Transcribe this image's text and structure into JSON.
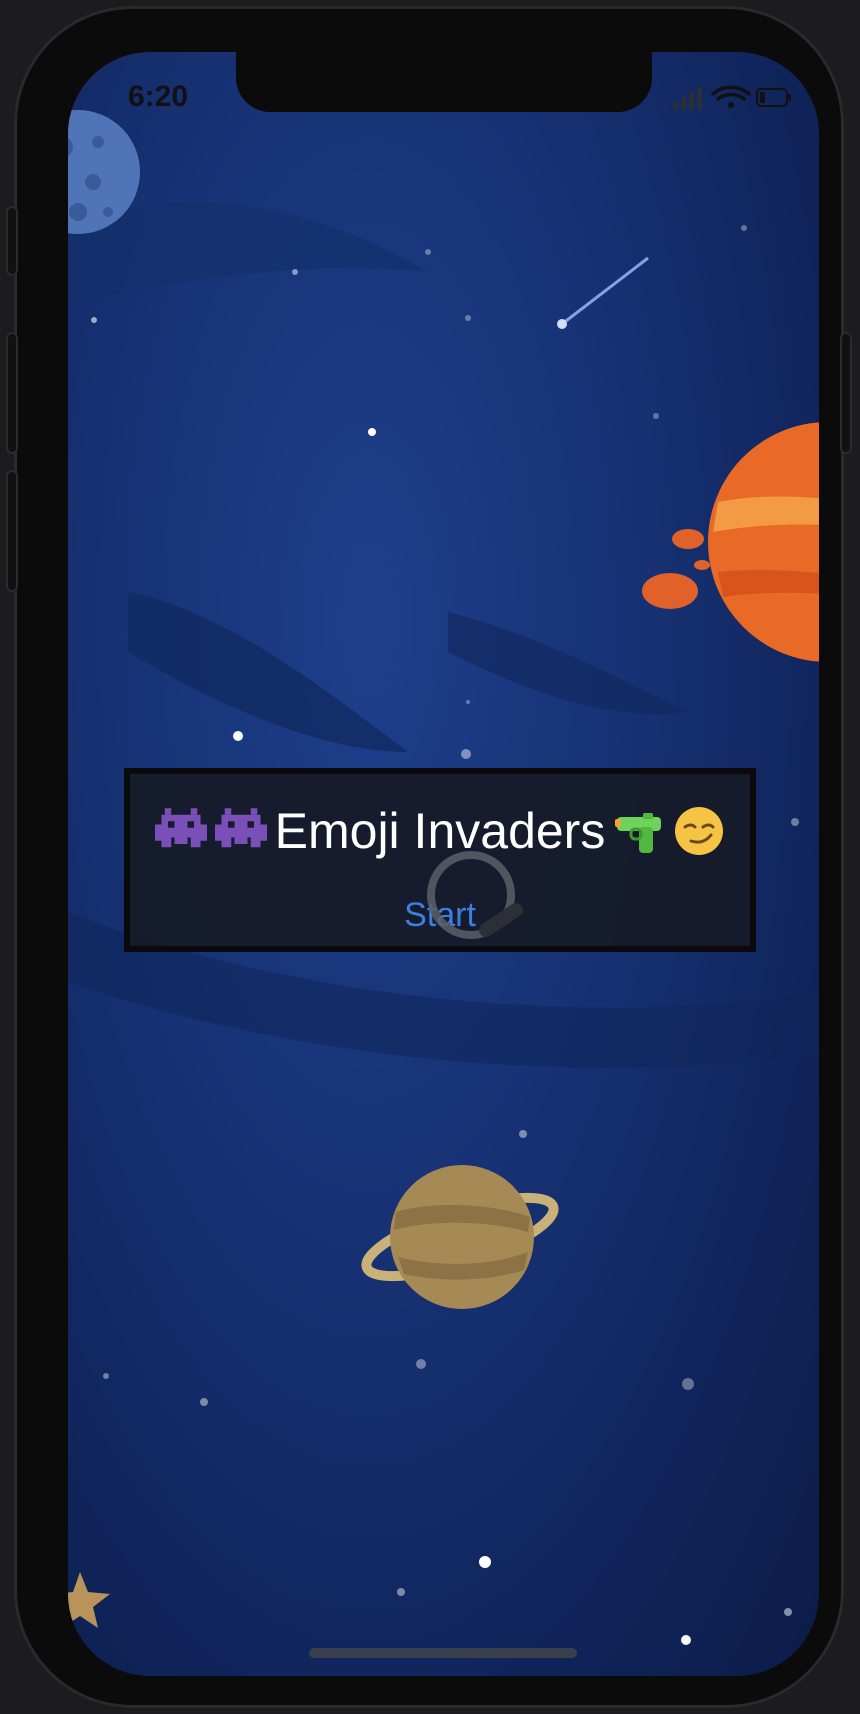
{
  "status_bar": {
    "time": "6:20"
  },
  "game": {
    "title": "Emoji Invaders",
    "start_label": "Start"
  },
  "icons": {
    "left": [
      "alien-monster-icon",
      "alien-monster-icon"
    ],
    "right": [
      "water-pistol-icon",
      "smirking-face-icon"
    ]
  },
  "colors": {
    "background": "#173275",
    "start_link": "#3d7fe0",
    "dialog": "#161a26"
  }
}
